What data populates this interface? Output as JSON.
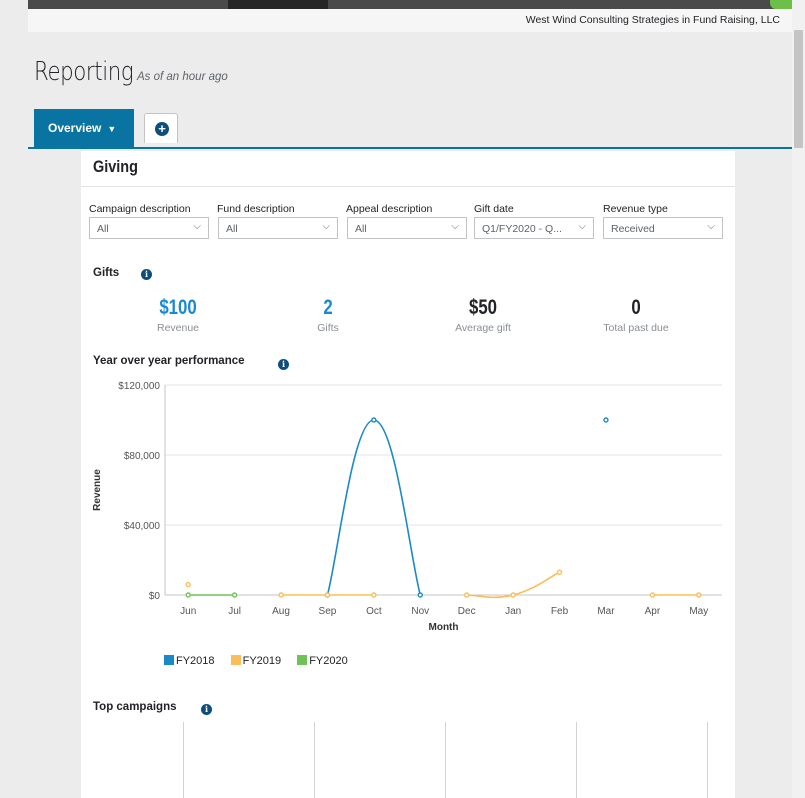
{
  "org_name": "West Wind Consulting Strategies in Fund Raising, LLC",
  "page": {
    "title": "Reporting",
    "subtitle": "As of an hour ago"
  },
  "tabs": {
    "overview_label": "Overview",
    "overview_icon": "caret-down-icon",
    "add_icon": "plus-circle-icon"
  },
  "card": {
    "title": "Giving"
  },
  "filters": [
    {
      "label": "Campaign description",
      "value": "All"
    },
    {
      "label": "Fund description",
      "value": "All"
    },
    {
      "label": "Appeal description",
      "value": "All"
    },
    {
      "label": "Gift date",
      "value": "Q1/FY2020 - Q..."
    },
    {
      "label": "Revenue type",
      "value": "Received"
    }
  ],
  "gifts": {
    "label": "Gifts",
    "kpis": [
      {
        "value": "$100",
        "label": "Revenue",
        "color": "#1a8ad0"
      },
      {
        "value": "2",
        "label": "Gifts",
        "color": "#1a8ad0"
      },
      {
        "value": "$50",
        "label": "Average gift",
        "color": "#212327"
      },
      {
        "value": "0",
        "label": "Total past due",
        "color": "#212327"
      }
    ]
  },
  "yoy": {
    "label": "Year over year performance"
  },
  "top_campaigns": {
    "label": "Top campaigns"
  },
  "colors": {
    "accent": "#0974a1",
    "fy2018": "#1a8ac6",
    "fy2019": "#fbbd59",
    "fy2020": "#71c256"
  },
  "chart_data": {
    "type": "line",
    "title": "",
    "xlabel": "Month",
    "ylabel": "Revenue",
    "categories": [
      "Jun",
      "Jul",
      "Aug",
      "Sep",
      "Oct",
      "Nov",
      "Dec",
      "Jan",
      "Feb",
      "Mar",
      "Apr",
      "May"
    ],
    "ylim": [
      0,
      120000
    ],
    "yticks": [
      "$0",
      "$40,000",
      "$80,000",
      "$120,000"
    ],
    "ytick_values": [
      0,
      40000,
      80000,
      120000
    ],
    "grid": true,
    "legend_position": "bottom-left",
    "series": [
      {
        "name": "FY2018",
        "color": "#1a8ac6",
        "values": [
          null,
          null,
          null,
          0,
          100000,
          0,
          null,
          null,
          null,
          100000,
          null,
          null
        ]
      },
      {
        "name": "FY2019",
        "color": "#fbbd59",
        "values": [
          6000,
          null,
          0,
          0,
          0,
          null,
          0,
          0,
          13000,
          null,
          0,
          0
        ]
      },
      {
        "name": "FY2020",
        "color": "#71c256",
        "values": [
          0,
          0,
          null,
          null,
          null,
          null,
          null,
          null,
          null,
          null,
          null,
          null
        ]
      }
    ]
  }
}
